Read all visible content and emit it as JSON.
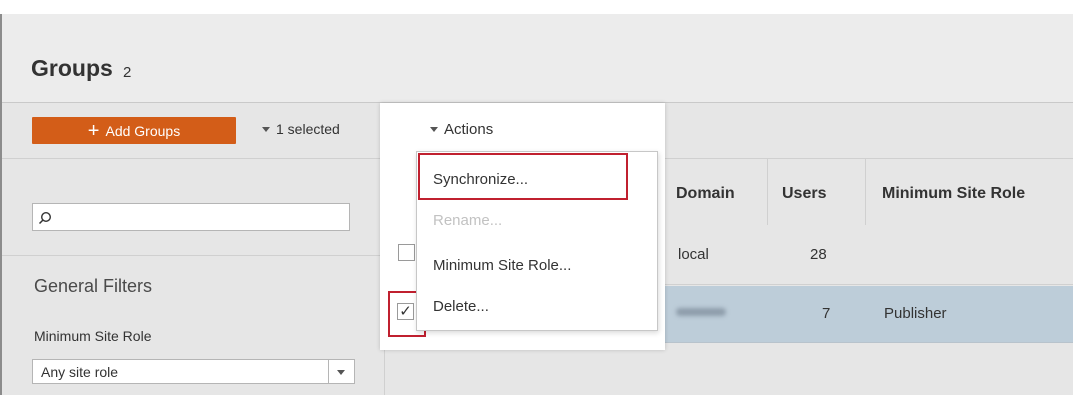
{
  "header": {
    "title": "Groups",
    "count": "2"
  },
  "toolbar": {
    "add_button_label": "Add Groups",
    "selected_label": "1 selected",
    "actions_label": "Actions"
  },
  "actions_menu": {
    "items": [
      {
        "label": "Synchronize...",
        "enabled": true,
        "highlighted": true
      },
      {
        "label": "Rename...",
        "enabled": false
      },
      {
        "label": "Minimum Site Role...",
        "enabled": true
      },
      {
        "label": "Delete...",
        "enabled": true
      }
    ]
  },
  "filters": {
    "search_placeholder": "",
    "heading": "General Filters",
    "min_role_label": "Minimum Site Role",
    "min_role_value": "Any site role"
  },
  "table": {
    "columns": [
      "Domain",
      "Users",
      "Minimum Site Role"
    ],
    "rows": [
      {
        "checked": false,
        "domain": "local",
        "users": "28",
        "min_role": ""
      },
      {
        "checked": true,
        "domain": "",
        "users": "7",
        "min_role": "Publisher"
      }
    ]
  },
  "colors": {
    "accent": "#d35d18",
    "highlight_outline": "#c0202f",
    "selected_row": "#bdcdd9",
    "background": "#e6e6e6"
  },
  "icons": {
    "add": "plus-icon",
    "search": "search-icon",
    "dropdown": "chevron-down-icon",
    "check": "checkmark-icon"
  }
}
